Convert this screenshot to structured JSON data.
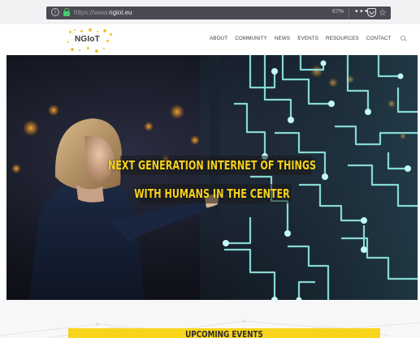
{
  "browser": {
    "url_prefix": "https://www.",
    "url_domain": "ngiot.eu",
    "zoom": "67%",
    "more_icon": "ellipsis-icon",
    "pocket_icon": "pocket-icon",
    "star_icon": "star-icon"
  },
  "site": {
    "logo_text": "NGIoT",
    "nav": [
      {
        "label": "ABOUT"
      },
      {
        "label": "COMMUNITY"
      },
      {
        "label": "NEWS"
      },
      {
        "label": "EVENTS"
      },
      {
        "label": "RESOURCES"
      },
      {
        "label": "CONTACT"
      }
    ]
  },
  "hero": {
    "headline_line1": "NEXT GENERATION INTERNET OF THINGS",
    "headline_line2": "WITH HUMANS IN THE CENTER"
  },
  "events": {
    "title": "UPCOMING EVENTS"
  },
  "colors": {
    "brand_yellow": "#f8d41c",
    "circuit_cyan": "#8fe8e0",
    "text_dark": "#3d3d3d"
  }
}
